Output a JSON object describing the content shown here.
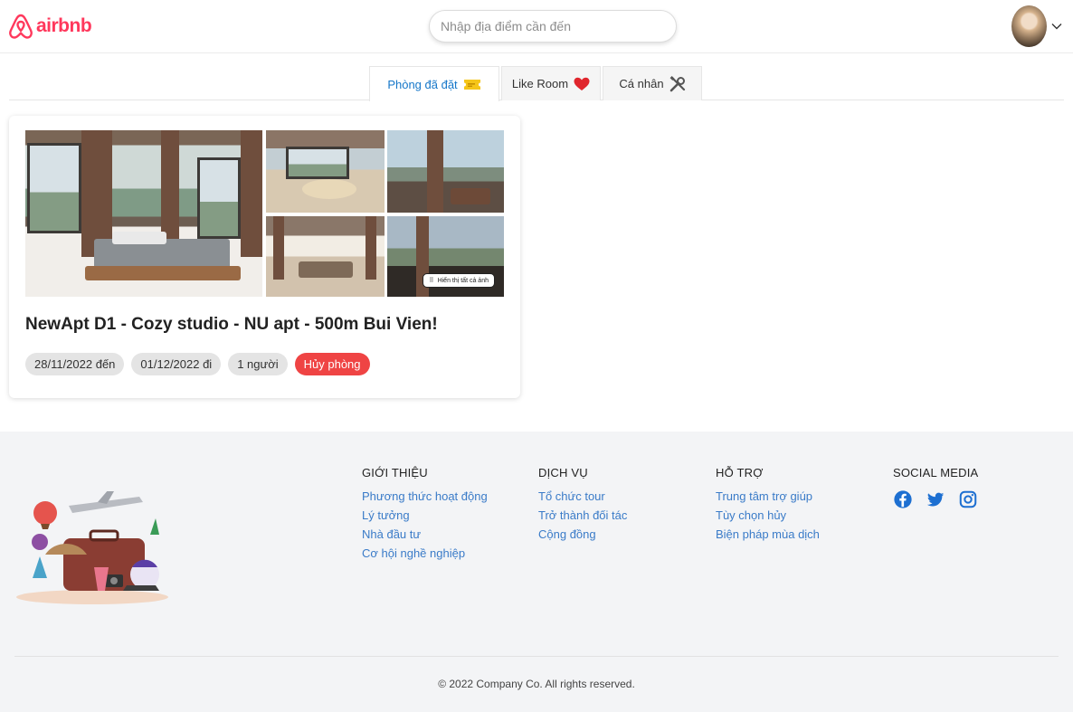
{
  "brand": {
    "name": "airbnb",
    "color": "#ff385c"
  },
  "search": {
    "placeholder": "Nhập địa điểm cần đến",
    "value": ""
  },
  "tabs": [
    {
      "label": "Phòng đã đặt",
      "icon": "ticket-icon",
      "active": true
    },
    {
      "label": "Like Room",
      "icon": "heart-icon",
      "active": false
    },
    {
      "label": "Cá nhân",
      "icon": "tools-icon",
      "active": false
    }
  ],
  "booking": {
    "title": "NewApt D1 - Cozy studio - NU apt - 500m Bui Vien!",
    "show_all_label": "Hiển thị tất cả ảnh",
    "check_in": "28/11/2022 đến",
    "check_out": "01/12/2022 đi",
    "guests": "1 người",
    "cancel_label": "Hủy phòng"
  },
  "footer": {
    "columns": [
      {
        "heading": "GIỚI THIỆU",
        "links": [
          "Phương thức hoạt động",
          "Lý tưởng",
          "Nhà đầu tư",
          "Cơ hội nghề nghiệp"
        ]
      },
      {
        "heading": "DỊCH VỤ",
        "links": [
          "Tổ chức tour",
          "Trở thành đối tác",
          "Cộng đồng"
        ]
      },
      {
        "heading": "HỖ TRỢ",
        "links": [
          "Trung tâm trợ giúp",
          "Tùy chọn hủy",
          "Biện pháp mùa dịch"
        ]
      }
    ],
    "social_heading": "SOCIAL MEDIA",
    "social_icons": [
      "facebook-icon",
      "twitter-icon",
      "instagram-icon"
    ],
    "copyright": "© 2022 Company Co. All rights reserved."
  },
  "colors": {
    "accent": "#1677c9",
    "cancel": "#ef4444",
    "link": "#3a7bc8",
    "social": "#1d6fd1"
  }
}
